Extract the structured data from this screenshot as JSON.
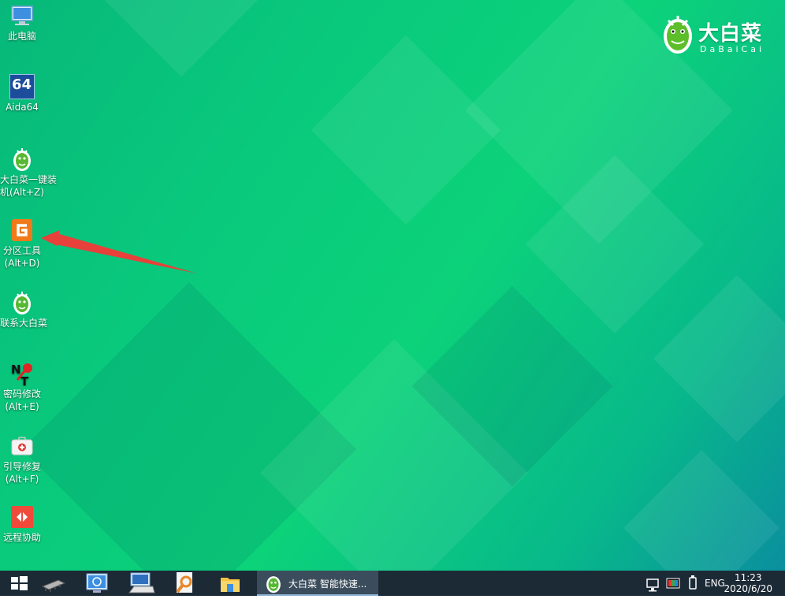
{
  "desktop": {
    "icons": [
      {
        "label1": "此电脑",
        "label2": ""
      },
      {
        "label1": "Aida64",
        "label2": ""
      },
      {
        "label1": "大白菜一键装",
        "label2": "机(Alt+Z)"
      },
      {
        "label1": "分区工具",
        "label2": "(Alt+D)"
      },
      {
        "label1": "联系大白菜",
        "label2": ""
      },
      {
        "label1": "密码修改",
        "label2": "(Alt+E)"
      },
      {
        "label1": "引导修复",
        "label2": "(Alt+F)"
      },
      {
        "label1": "远程协助",
        "label2": ""
      }
    ],
    "aida_badge": "64",
    "logo": {
      "title": "大白菜",
      "subtitle": "DaBaiCai"
    }
  },
  "taskbar": {
    "task_label": "大白菜 智能快速...",
    "language": "ENG",
    "time": "11:23",
    "date": "2020/6/20"
  },
  "colors": {
    "arrow": "#e8403a",
    "taskbar": "#1c2a36"
  }
}
